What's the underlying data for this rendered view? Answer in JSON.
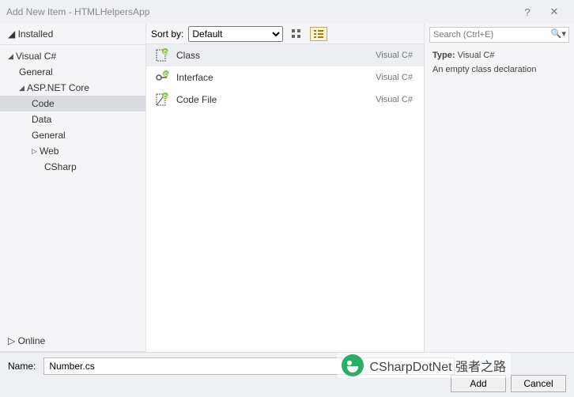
{
  "title": "Add New Item - HTMLHelpersApp",
  "sidebar": {
    "installed": "Installed",
    "online": "Online",
    "tree": {
      "root": "Visual C#",
      "general": "General",
      "aspnet": "ASP.NET Core",
      "code": "Code",
      "data": "Data",
      "general2": "General",
      "web": "Web",
      "csharp": "CSharp"
    }
  },
  "toolbar": {
    "sortby": "Sort by:",
    "options": [
      "Default"
    ],
    "selected": "Default"
  },
  "items": [
    {
      "name": "Class",
      "lang": "Visual C#"
    },
    {
      "name": "Interface",
      "lang": "Visual C#"
    },
    {
      "name": "Code File",
      "lang": "Visual C#"
    }
  ],
  "search": {
    "placeholder": "Search (Ctrl+E)"
  },
  "info": {
    "type_label": "Type:",
    "type_value": "Visual C#",
    "desc": "An empty class declaration"
  },
  "footer": {
    "name_label": "Name:",
    "name_value": "Number.cs",
    "add": "Add",
    "cancel": "Cancel"
  },
  "watermark": "CSharpDotNet 强者之路"
}
